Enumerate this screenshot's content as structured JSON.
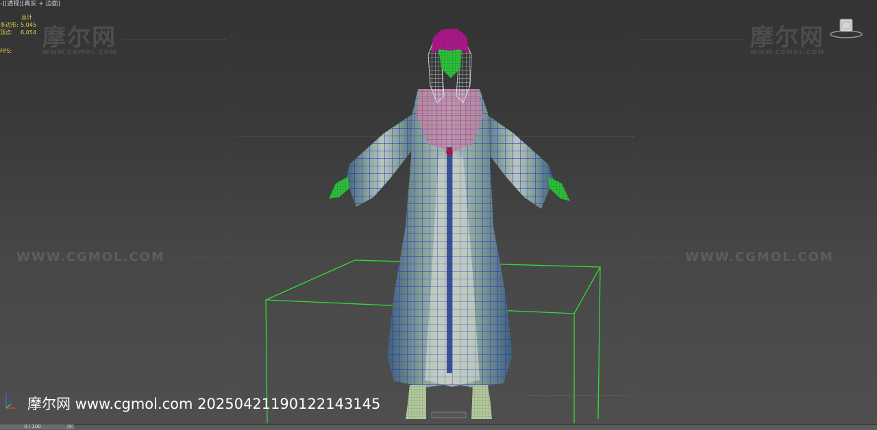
{
  "viewport": {
    "label_prefix": "-][",
    "view_name": "透视",
    "label_sep": "][",
    "shading_mode": "真实 + 边面",
    "label_suffix": "]"
  },
  "stats": {
    "header": "总计",
    "polys_label": "多边形:",
    "polys_value": "5,045",
    "verts_label": "顶点:",
    "verts_value": "6,054",
    "fps_label": "FPS:"
  },
  "watermarks": {
    "logo_text": "摩尔网",
    "logo_sub": "WWW.CGMOL.COM",
    "url_text": "WWW.CGMOL.COM",
    "bottom_text": "摩尔网 www.cgmol.com 20250421190122143145"
  },
  "timeline": {
    "frame_display": "0 / 100",
    "next_label": ">"
  },
  "icons": {
    "viewcube": "viewcube-icon",
    "axis": "axis-tripod-icon"
  },
  "colors": {
    "stats_text": "#e8d24a",
    "bbox_green": "#33dd33",
    "wire_blue": "#1a2bd6",
    "hair_magenta": "#c0169a"
  }
}
